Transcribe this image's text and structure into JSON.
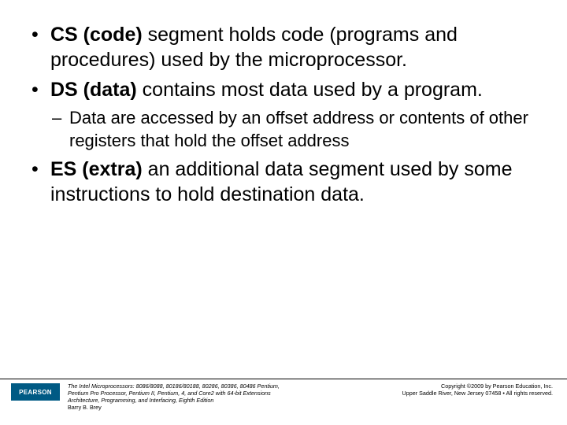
{
  "bullets": {
    "b1_bold": "CS (code)",
    "b1_rest": " segment holds code (programs and procedures) used by the microprocessor.",
    "b2_bold": "DS (data)",
    "b2_rest": " contains most data used by a program.",
    "b2_sub1": "Data are accessed by an offset address or contents of other registers that hold the offset address",
    "b3_bold": "ES (extra)",
    "b3_rest": " an additional data segment used by some instructions to hold destination data."
  },
  "footer": {
    "logo": "PEARSON",
    "book_line1": "The Intel Microprocessors: 8086/8088, 80186/80188, 80286, 80386, 80486 Pentium,",
    "book_line2": "Pentium Pro Processor, Pentium II, Pentium, 4, and Core2 with 64-bit Extensions",
    "book_line3": "Architecture, Programming, and Interfacing, Eighth Edition",
    "book_author": "Barry B. Brey",
    "copy_line1": "Copyright ©2009 by Pearson Education, Inc.",
    "copy_line2": "Upper Saddle River, New Jersey 07458 • All rights reserved."
  }
}
